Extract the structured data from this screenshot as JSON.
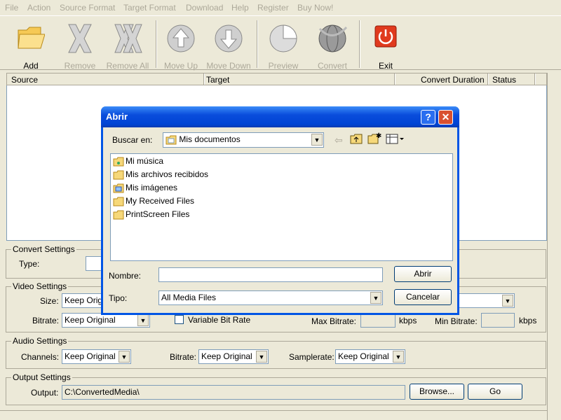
{
  "menu": [
    "File",
    "Action",
    "Source Format",
    "Target Format",
    "Download",
    "Help",
    "Register",
    "Buy Now!"
  ],
  "toolbar": {
    "add": "Add",
    "remove": "Remove",
    "remove_all": "Remove All",
    "move_up": "Move Up",
    "move_down": "Move Down",
    "preview": "Preview",
    "convert": "Convert",
    "exit": "Exit"
  },
  "list_columns": [
    "Source",
    "Target",
    "Convert Duration",
    "Status"
  ],
  "convert_settings": {
    "label": "Convert Settings",
    "type_label": "Type:"
  },
  "video_settings": {
    "label": "Video Settings",
    "size_label": "Size:",
    "size_value": "Keep Original",
    "bitrate_label": "Bitrate:",
    "bitrate_value": "Keep Original",
    "vbr_label": "Variable Bit Rate",
    "max_bitrate_label": "Max Bitrate:",
    "min_bitrate_label": "Min Bitrate:",
    "unit1": "kbps",
    "unit2": "kbps"
  },
  "audio_settings": {
    "label": "Audio Settings",
    "channels_label": "Channels:",
    "channels_value": "Keep Original",
    "bitrate_label": "Bitrate:",
    "bitrate_value": "Keep Original",
    "samplerate_label": "Samplerate:",
    "samplerate_value": "Keep Original"
  },
  "output_settings": {
    "label": "Output Settings",
    "output_label": "Output:",
    "output_value": "C:\\ConvertedMedia\\",
    "browse": "Browse...",
    "go": "Go"
  },
  "dialog": {
    "title": "Abrir",
    "help": "?",
    "close": "✕",
    "look_in_label": "Buscar en:",
    "look_in_value": "Mis documentos",
    "files": [
      "Mi música",
      "Mis archivos recibidos",
      "Mis imágenes",
      "My Received Files",
      "PrintScreen Files"
    ],
    "name_label": "Nombre:",
    "name_value": "",
    "type_label": "Tipo:",
    "type_value": "All Media Files",
    "open_button": "Abrir",
    "cancel_button": "Cancelar"
  },
  "colors": {
    "titlebar": "#0a4ddc",
    "accent_exit": "#e03a1e"
  }
}
